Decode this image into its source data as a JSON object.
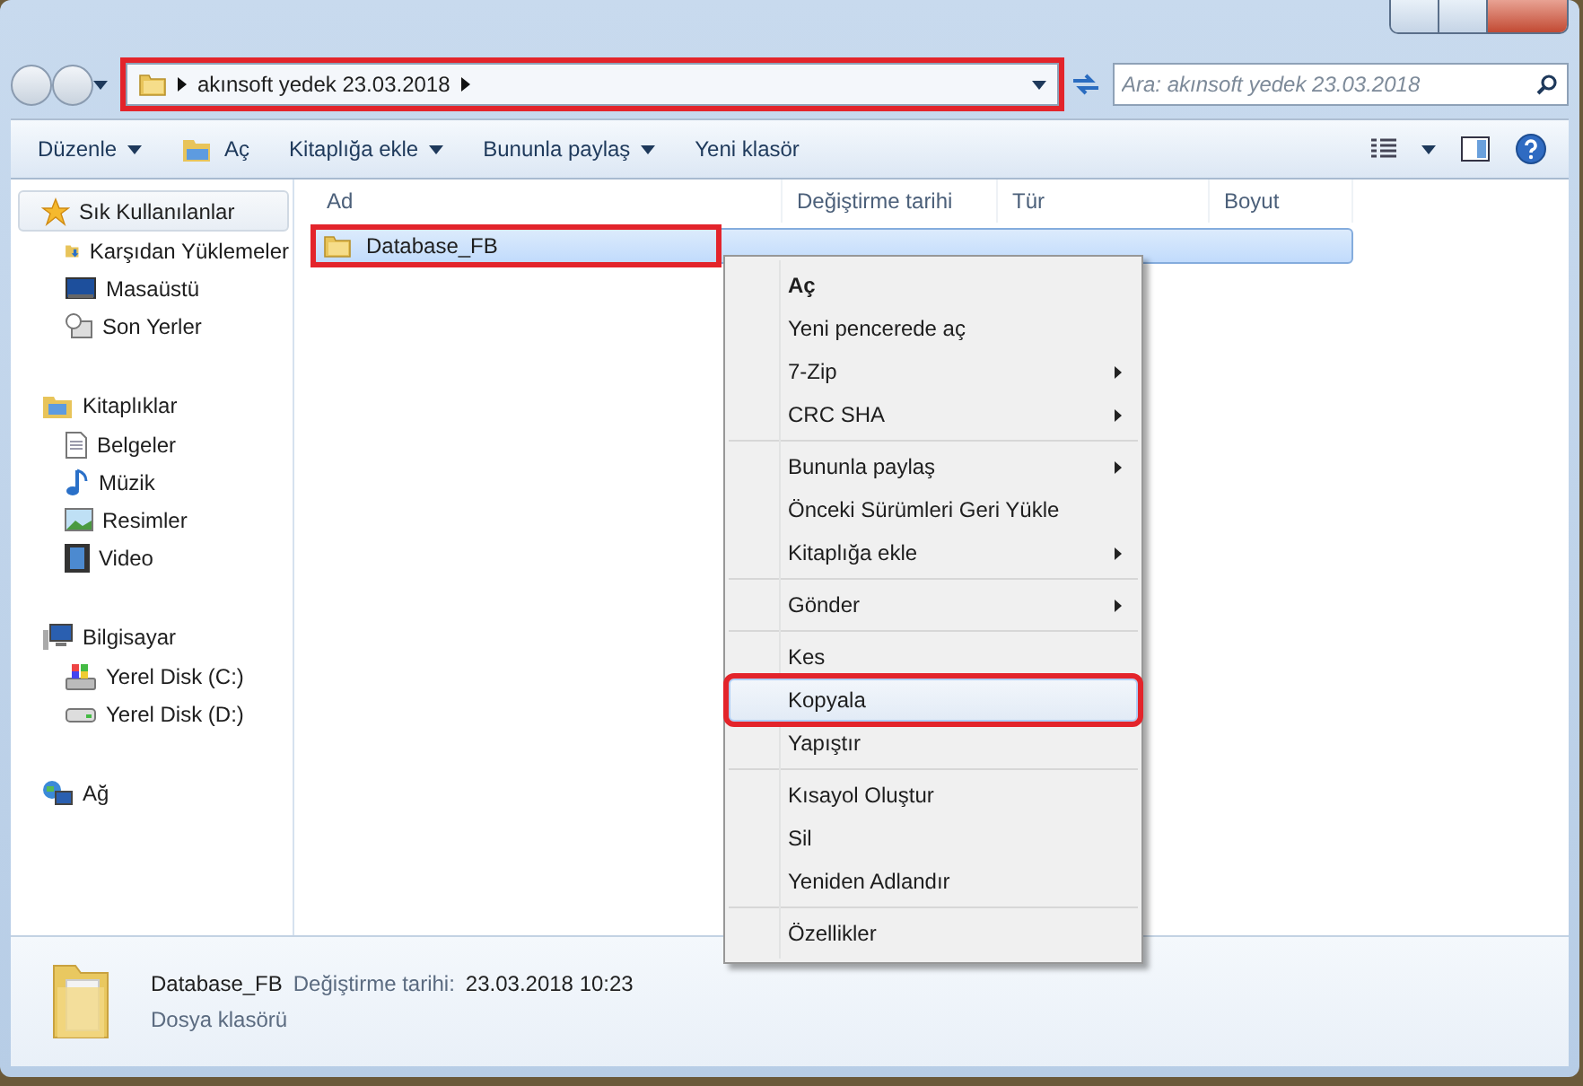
{
  "address_bar": {
    "path": [
      "akınsoft yedek 23.03.2018"
    ],
    "highlighted": true
  },
  "search": {
    "placeholder": "Ara: akınsoft yedek 23.03.2018"
  },
  "toolbar": {
    "buttons": [
      {
        "label": "Düzenle",
        "dropdown": true
      },
      {
        "label": "Aç",
        "dropdown": false
      },
      {
        "label": "Kitaplığa ekle",
        "dropdown": true
      },
      {
        "label": "Bununla paylaş",
        "dropdown": true
      },
      {
        "label": "Yeni klasör",
        "dropdown": false
      }
    ]
  },
  "sidebar": {
    "items": [
      {
        "label": "Sık Kullanılanlar",
        "selected": true,
        "children": [
          {
            "label": "Karşıdan Yüklemeler",
            "selected": false
          },
          {
            "label": "Masaüstü",
            "selected": false
          },
          {
            "label": "Son Yerler",
            "selected": false
          }
        ]
      },
      {
        "label": "Kitaplıklar",
        "selected": false,
        "children": [
          {
            "label": "Belgeler",
            "selected": false
          },
          {
            "label": "Müzik",
            "selected": false
          },
          {
            "label": "Resimler",
            "selected": false
          },
          {
            "label": "Video",
            "selected": false
          }
        ]
      },
      {
        "label": "Bilgisayar",
        "selected": false,
        "children": [
          {
            "label": "Yerel Disk (C:)",
            "selected": false
          },
          {
            "label": "Yerel Disk (D:)",
            "selected": false
          }
        ]
      },
      {
        "label": "Ağ",
        "selected": false
      }
    ]
  },
  "table": {
    "columns": [
      "Ad",
      "Değiştirme tarihi",
      "Tür",
      "Boyut"
    ],
    "rows": [
      {
        "name": "Database_FB",
        "selected": true,
        "highlighted": true
      }
    ]
  },
  "context_menu": {
    "groups": [
      [
        {
          "label": "Aç",
          "bold": true,
          "submenu": false,
          "selected": false,
          "highlighted": false
        },
        {
          "label": "Yeni pencerede aç",
          "bold": false,
          "submenu": false,
          "selected": false,
          "highlighted": false
        },
        {
          "label": "7-Zip",
          "bold": false,
          "submenu": true,
          "selected": false,
          "highlighted": false
        },
        {
          "label": "CRC SHA",
          "bold": false,
          "submenu": true,
          "selected": false,
          "highlighted": false
        }
      ],
      [
        {
          "label": "Bununla paylaş",
          "bold": false,
          "submenu": true,
          "selected": false,
          "highlighted": false
        },
        {
          "label": "Önceki Sürümleri Geri Yükle",
          "bold": false,
          "submenu": false,
          "selected": false,
          "highlighted": false
        },
        {
          "label": "Kitaplığa ekle",
          "bold": false,
          "submenu": true,
          "selected": false,
          "highlighted": false
        }
      ],
      [
        {
          "label": "Gönder",
          "bold": false,
          "submenu": true,
          "selected": false,
          "highlighted": false
        }
      ],
      [
        {
          "label": "Kes",
          "bold": false,
          "submenu": false,
          "selected": false,
          "highlighted": false
        },
        {
          "label": "Kopyala",
          "bold": false,
          "submenu": false,
          "selected": true,
          "highlighted": true
        },
        {
          "label": "Yapıştır",
          "bold": false,
          "submenu": false,
          "selected": false,
          "highlighted": false
        }
      ],
      [
        {
          "label": "Kısayol Oluştur",
          "bold": false,
          "submenu": false,
          "selected": false,
          "highlighted": false
        },
        {
          "label": "Sil",
          "bold": false,
          "submenu": false,
          "selected": false,
          "highlighted": false
        },
        {
          "label": "Yeniden Adlandır",
          "bold": false,
          "submenu": false,
          "selected": false,
          "highlighted": false
        }
      ],
      [
        {
          "label": "Özellikler",
          "bold": false,
          "submenu": false,
          "selected": false,
          "highlighted": false
        }
      ]
    ]
  },
  "details_pane": {
    "name": "Database_FB",
    "date_label": "Değiştirme tarihi:",
    "date": "23.03.2018 10:23",
    "type": "Dosya klasörü"
  }
}
